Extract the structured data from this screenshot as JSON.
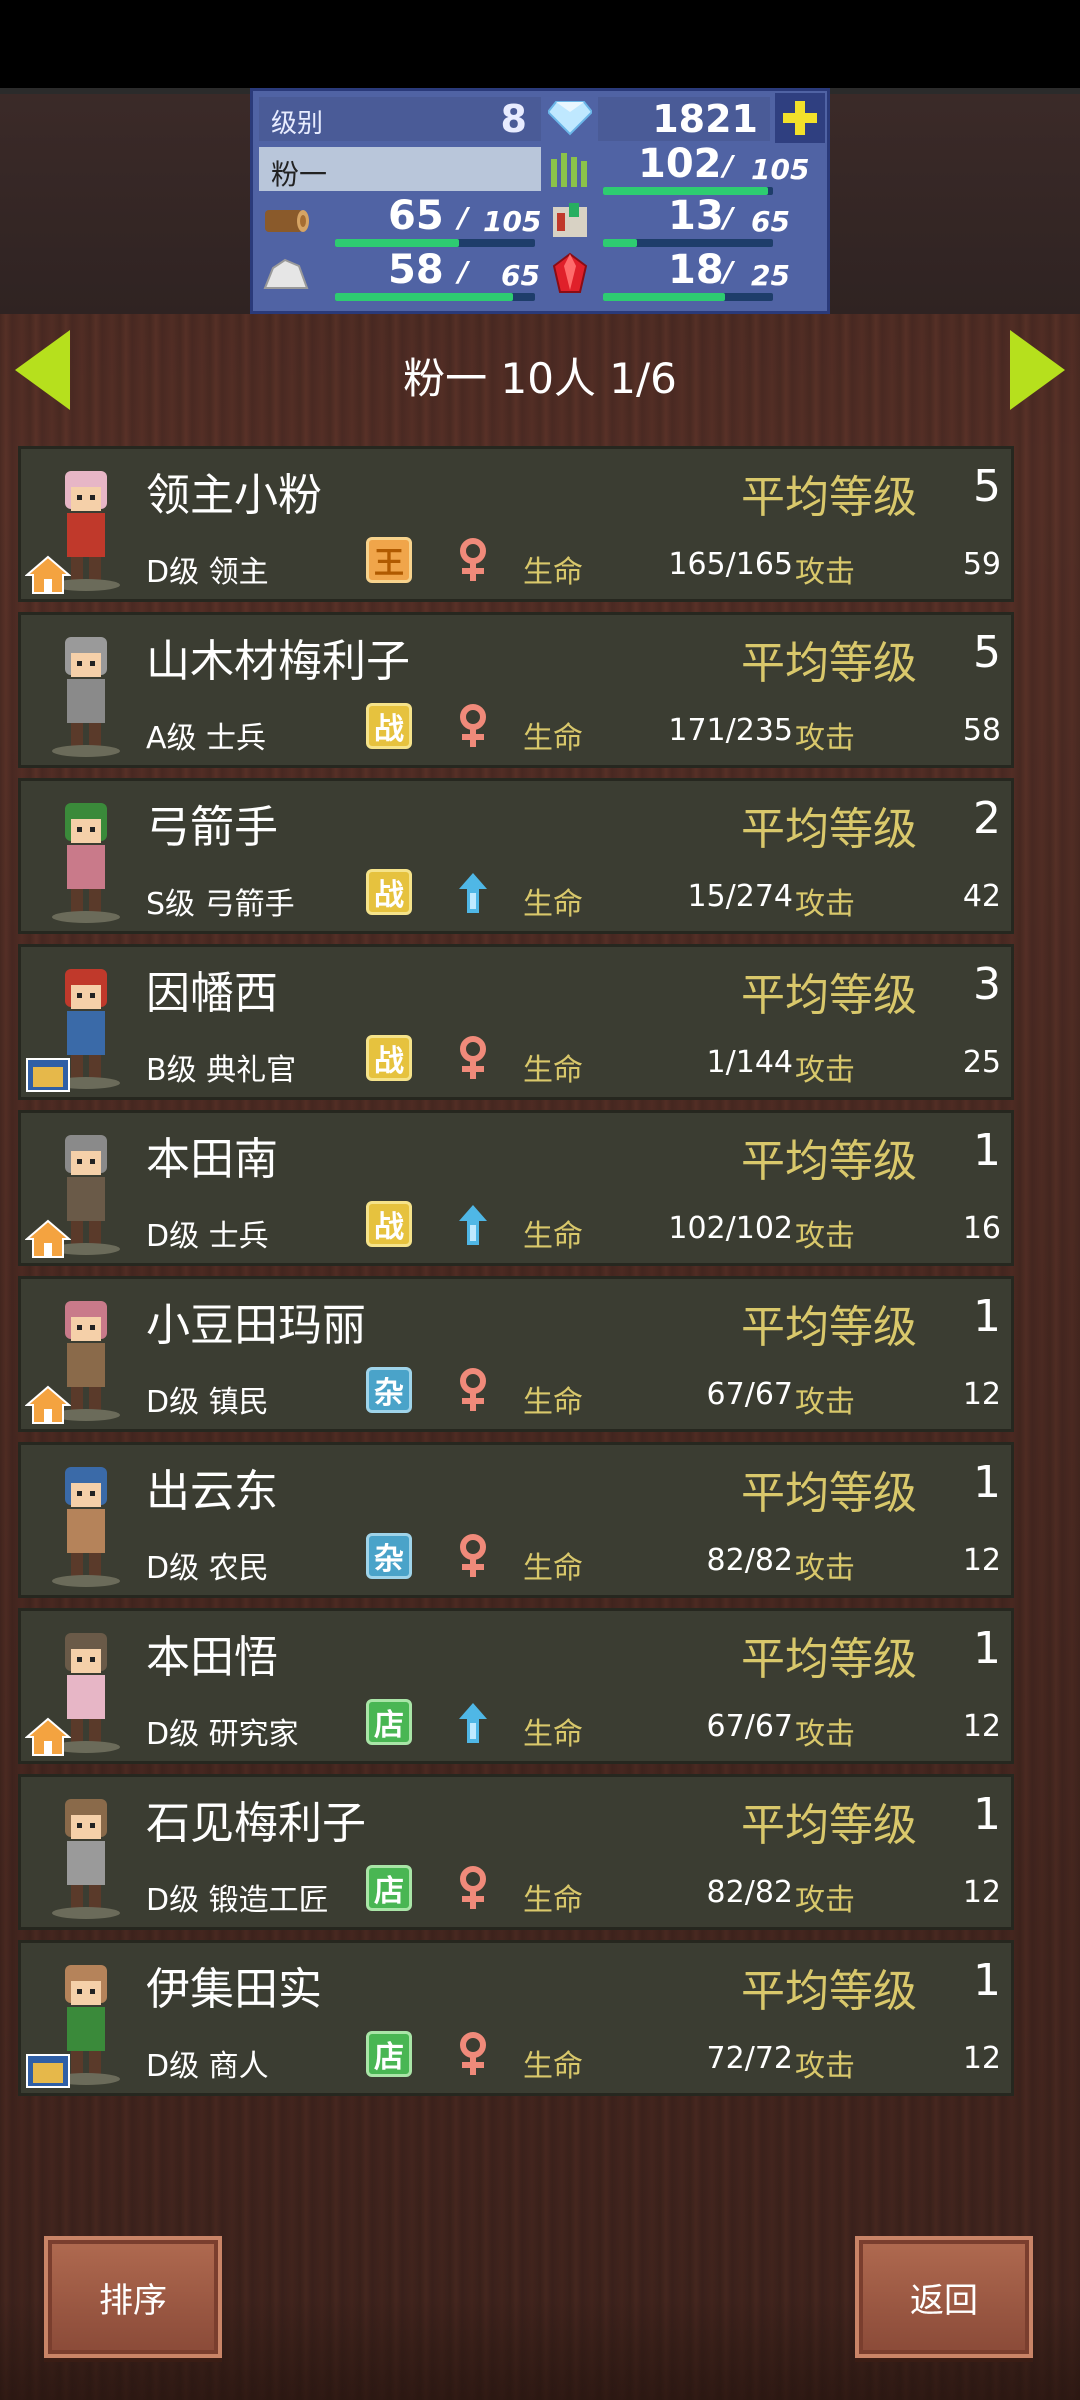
{
  "resources": {
    "level_label": "级别",
    "level_value": "8",
    "gems": "1821",
    "group_name": "粉一",
    "grass_current": "102",
    "grass_max": "105",
    "grass_fraction": 0.97,
    "wood_current": "65",
    "wood_max": "105",
    "wood_fraction": 0.62,
    "food_current": "13",
    "food_max": "65",
    "food_fraction": 0.2,
    "ore_current": "58",
    "ore_max": "65",
    "ore_fraction": 0.89,
    "crystal_current": "18",
    "crystal_max": "25",
    "crystal_fraction": 0.72,
    "slash": "/"
  },
  "nav": {
    "title": "粉一  10人 1/6"
  },
  "labels": {
    "avg_level": "平均等级",
    "life": "生命",
    "attack": "攻击"
  },
  "units": [
    {
      "name": "领主小粉",
      "avg_level": "5",
      "rank": "D级 领主",
      "job_badge": "王",
      "badge_type": "wang",
      "gender": "female",
      "hp": "165/165",
      "atk": "59",
      "house": "home"
    },
    {
      "name": "山木材梅利子",
      "avg_level": "5",
      "rank": "A级 士兵",
      "job_badge": "战",
      "badge_type": "zhan",
      "gender": "female",
      "hp": "171/235",
      "atk": "58",
      "house": "none"
    },
    {
      "name": "弓箭手",
      "avg_level": "2",
      "rank": "S级 弓箭手",
      "job_badge": "战",
      "badge_type": "zhan",
      "gender": "male",
      "hp": "15/274",
      "atk": "42",
      "house": "none"
    },
    {
      "name": "因幡西",
      "avg_level": "3",
      "rank": "B级 典礼官",
      "job_badge": "战",
      "badge_type": "zhan",
      "gender": "female",
      "hp": "1/144",
      "atk": "25",
      "house": "shop"
    },
    {
      "name": "本田南",
      "avg_level": "1",
      "rank": "D级 士兵",
      "job_badge": "战",
      "badge_type": "zhan",
      "gender": "male",
      "hp": "102/102",
      "atk": "16",
      "house": "home"
    },
    {
      "name": "小豆田玛丽",
      "avg_level": "1",
      "rank": "D级 镇民",
      "job_badge": "杂",
      "badge_type": "za",
      "gender": "female",
      "hp": "67/67",
      "atk": "12",
      "house": "home"
    },
    {
      "name": "出云东",
      "avg_level": "1",
      "rank": "D级 农民",
      "job_badge": "杂",
      "badge_type": "za",
      "gender": "female",
      "hp": "82/82",
      "atk": "12",
      "house": "none"
    },
    {
      "name": "本田悟",
      "avg_level": "1",
      "rank": "D级 研究家",
      "job_badge": "店",
      "badge_type": "dian",
      "gender": "male",
      "hp": "67/67",
      "atk": "12",
      "house": "home"
    },
    {
      "name": "石见梅利子",
      "avg_level": "1",
      "rank": "D级 锻造工匠",
      "job_badge": "店",
      "badge_type": "dian",
      "gender": "female",
      "hp": "82/82",
      "atk": "12",
      "house": "none"
    },
    {
      "name": "伊集田实",
      "avg_level": "1",
      "rank": "D级 商人",
      "job_badge": "店",
      "badge_type": "dian",
      "gender": "female",
      "hp": "72/72",
      "atk": "12",
      "house": "shop"
    }
  ],
  "buttons": {
    "sort": "排序",
    "back": "返回"
  },
  "icons": {
    "gem": "diamond-icon",
    "plus": "plus-icon",
    "grass": "grass-icon",
    "wood": "wood-log-icon",
    "food": "food-icon",
    "ore": "ore-icon",
    "crystal": "red-crystal-icon"
  },
  "colors": {
    "accent_gold": "#d9c86b",
    "bar_green": "#2ecc71",
    "nav_arrow": "#b6e01d",
    "female": "#f08a7a",
    "male": "#4fb7e6"
  }
}
